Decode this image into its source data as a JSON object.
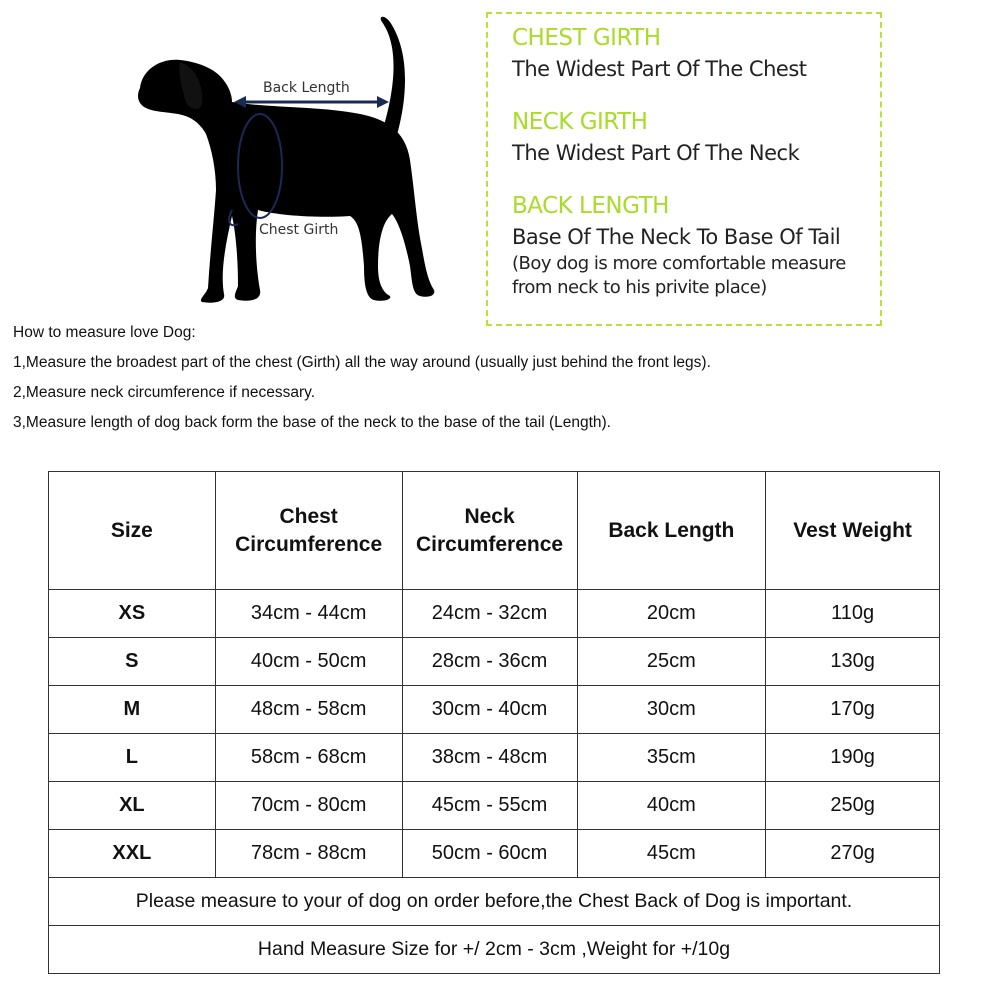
{
  "diagram": {
    "back_length_label": "Back Length",
    "chest_girth_label": "Chest Girth"
  },
  "info_box": {
    "sections": [
      {
        "heading": "CHEST GIRTH",
        "description": "The Widest Part Of The Chest"
      },
      {
        "heading": "NECK GIRTH",
        "description": "The Widest Part Of The Neck"
      },
      {
        "heading": "BACK LENGTH",
        "description": "Base Of The Neck To Base Of Tail",
        "note_line1": "(Boy dog is more comfortable measure",
        "note_line2": "from neck to his privite place)"
      }
    ],
    "accent_color": "#a8dc28"
  },
  "instructions": {
    "title": "How to measure love Dog:",
    "steps": [
      "1,Measure the broadest part of the chest (Girth) all the way around (usually just behind the front legs).",
      "2,Measure neck circumference if necessary.",
      "3,Measure length of dog back form the base of the neck to the base of the tail (Length)."
    ]
  },
  "size_table": {
    "headers": {
      "size": "Size",
      "chest_line1": "Chest",
      "chest_line2": "Circumference",
      "neck_line1": "Neck",
      "neck_line2": "Circumference",
      "back": "Back Length",
      "weight": "Vest Weight"
    },
    "rows": [
      {
        "size": "XS",
        "chest": "34cm - 44cm",
        "neck": "24cm - 32cm",
        "back": "20cm",
        "weight": "110g"
      },
      {
        "size": "S",
        "chest": "40cm - 50cm",
        "neck": "28cm - 36cm",
        "back": "25cm",
        "weight": "130g"
      },
      {
        "size": "M",
        "chest": "48cm - 58cm",
        "neck": "30cm - 40cm",
        "back": "30cm",
        "weight": "170g"
      },
      {
        "size": "L",
        "chest": "58cm - 68cm",
        "neck": "38cm - 48cm",
        "back": "35cm",
        "weight": "190g"
      },
      {
        "size": "XL",
        "chest": "70cm - 80cm",
        "neck": "45cm - 55cm",
        "back": "40cm",
        "weight": "250g"
      },
      {
        "size": "XXL",
        "chest": "78cm - 88cm",
        "neck": "50cm - 60cm",
        "back": "45cm",
        "weight": "270g"
      }
    ],
    "note1": "Please measure to your of dog on order before,the Chest Back of Dog is important.",
    "note2": "Hand Measure Size for +/ 2cm - 3cm ,Weight for +/10g"
  }
}
